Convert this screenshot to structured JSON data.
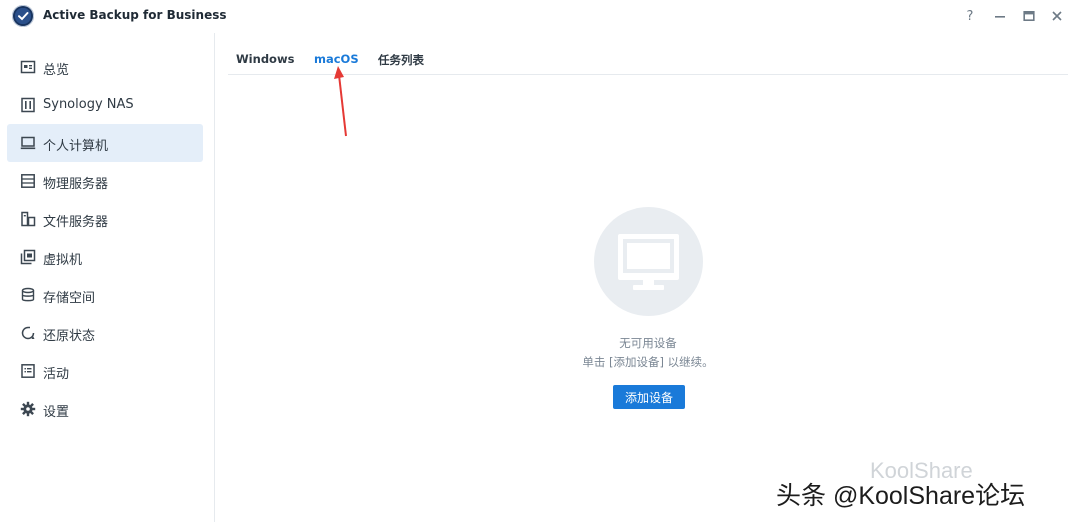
{
  "window": {
    "title": "Active Backup for Business",
    "controls": [
      "?",
      "minimize",
      "maximize",
      "close"
    ]
  },
  "sidebar": {
    "items": [
      {
        "label": "总览",
        "icon": "overview-icon",
        "active": false
      },
      {
        "label": "Synology NAS",
        "icon": "nas-icon",
        "active": false
      },
      {
        "label": "个人计算机",
        "icon": "pc-icon",
        "active": true
      },
      {
        "label": "物理服务器",
        "icon": "server-icon",
        "active": false
      },
      {
        "label": "文件服务器",
        "icon": "file-server-icon",
        "active": false
      },
      {
        "label": "虚拟机",
        "icon": "vm-icon",
        "active": false
      },
      {
        "label": "存储空间",
        "icon": "storage-icon",
        "active": false
      },
      {
        "label": "还原状态",
        "icon": "restore-icon",
        "active": false
      },
      {
        "label": "活动",
        "icon": "activity-icon",
        "active": false
      },
      {
        "label": "设置",
        "icon": "settings-icon",
        "active": false
      }
    ]
  },
  "tabs": [
    {
      "label": "Windows",
      "active": false
    },
    {
      "label": "macOS",
      "active": true
    },
    {
      "label": "任务列表",
      "active": false
    }
  ],
  "empty_state": {
    "icon": "monitor-icon",
    "title": "无可用设备",
    "subtitle": "单击 [添加设备] 以继续。",
    "button_label": "添加设备"
  },
  "watermark": {
    "text": "头条 @KoolShare论坛",
    "faint_text": "KoolShare"
  },
  "colors": {
    "accent": "#1a7ad9",
    "active_bg": "#e4eef9",
    "annotation_arrow": "#e53935"
  }
}
